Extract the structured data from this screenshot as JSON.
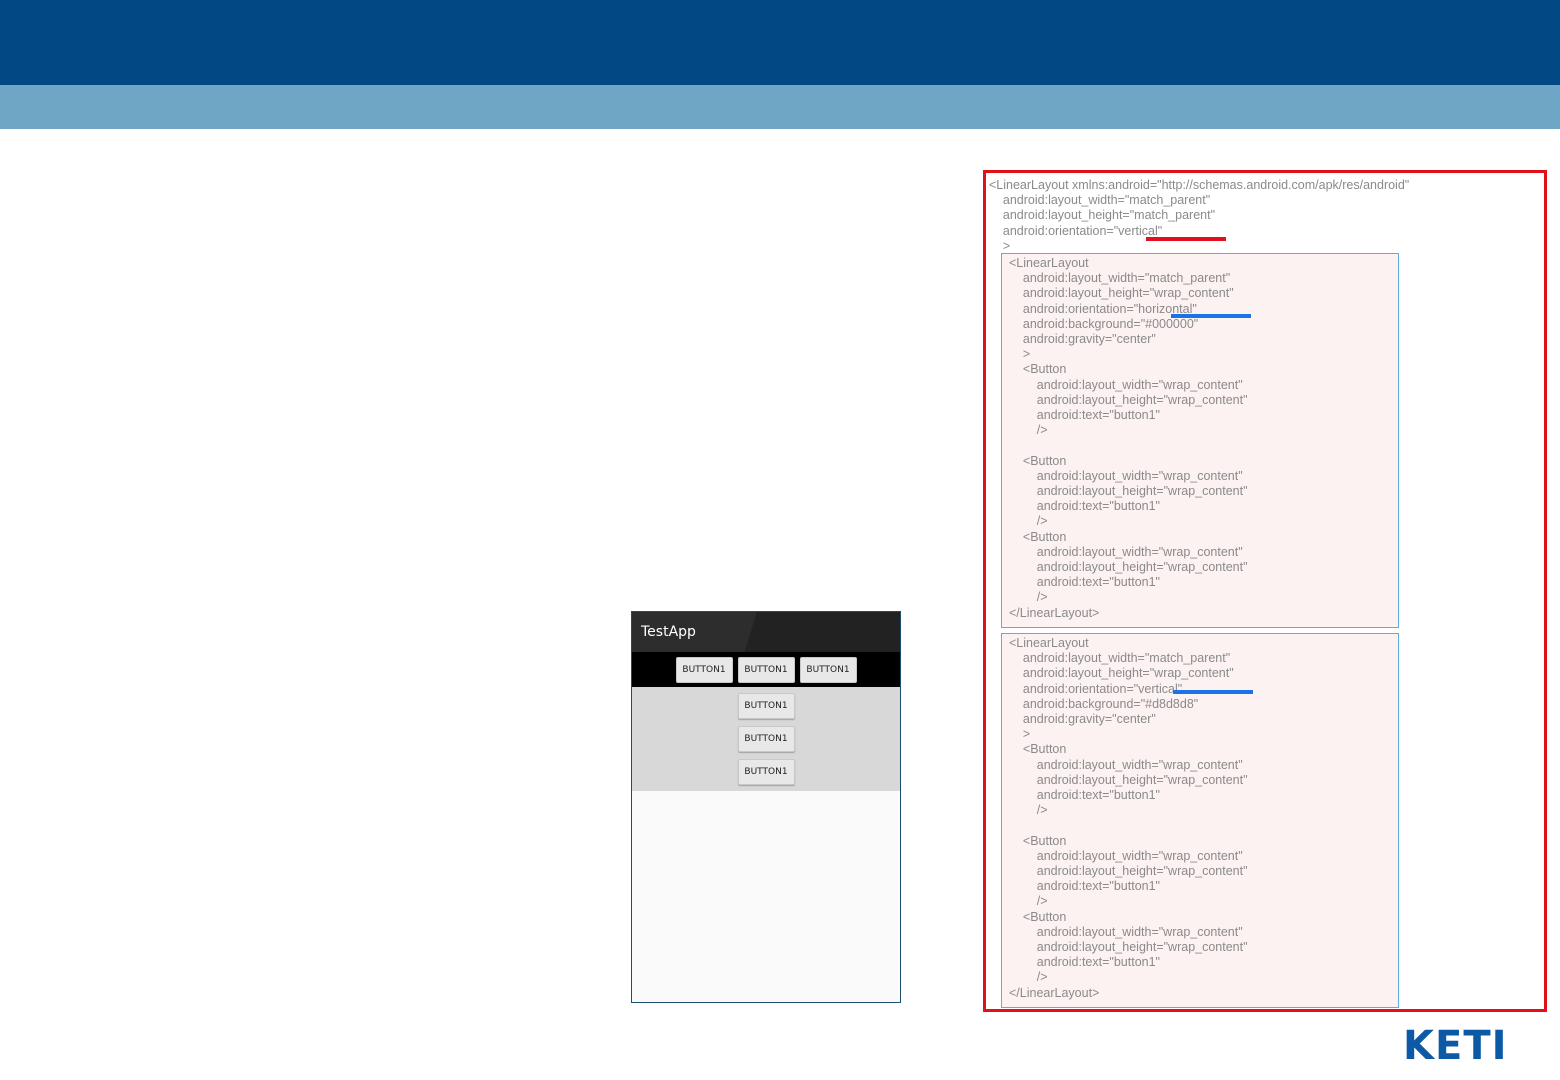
{
  "phone": {
    "app_title": "TestApp",
    "horizontal_buttons": [
      "BUTTON1",
      "BUTTON1",
      "BUTTON1"
    ],
    "vertical_buttons": [
      "BUTTON1",
      "BUTTON1",
      "BUTTON1"
    ]
  },
  "code": {
    "root": [
      "<LinearLayout xmlns:android=\"http://schemas.android.com/apk/res/android\"",
      "    android:layout_width=\"match_parent\"",
      "    android:layout_height=\"match_parent\"",
      "    android:orientation=\"vertical\"",
      "    >"
    ],
    "block1": [
      "<LinearLayout",
      "    android:layout_width=\"match_parent\"",
      "    android:layout_height=\"wrap_content\"",
      "    android:orientation=\"horizontal\"",
      "    android:background=\"#000000\"",
      "    android:gravity=\"center\"",
      "    >",
      "    <Button",
      "        android:layout_width=\"wrap_content\"",
      "        android:layout_height=\"wrap_content\"",
      "        android:text=\"button1\"",
      "        />",
      "",
      "    <Button",
      "        android:layout_width=\"wrap_content\"",
      "        android:layout_height=\"wrap_content\"",
      "        android:text=\"button1\"",
      "        />",
      "    <Button",
      "        android:layout_width=\"wrap_content\"",
      "        android:layout_height=\"wrap_content\"",
      "        android:text=\"button1\"",
      "        />",
      "</LinearLayout>"
    ],
    "block2": [
      "<LinearLayout",
      "    android:layout_width=\"match_parent\"",
      "    android:layout_height=\"wrap_content\"",
      "    android:orientation=\"vertical\"",
      "    android:background=\"#d8d8d8\"",
      "    android:gravity=\"center\"",
      "    >",
      "    <Button",
      "        android:layout_width=\"wrap_content\"",
      "        android:layout_height=\"wrap_content\"",
      "        android:text=\"button1\"",
      "        />",
      "",
      "    <Button",
      "        android:layout_width=\"wrap_content\"",
      "        android:layout_height=\"wrap_content\"",
      "        android:text=\"button1\"",
      "        />",
      "    <Button",
      "        android:layout_width=\"wrap_content\"",
      "        android:layout_height=\"wrap_content\"",
      "        android:text=\"button1\"",
      "        />",
      "</LinearLayout>"
    ]
  },
  "logo": {
    "text": "KETI"
  },
  "colors": {
    "header": "#024885",
    "subheader": "#6fa6c6",
    "highlight_red": "#e2101a",
    "highlight_blue": "#1a73e8"
  }
}
